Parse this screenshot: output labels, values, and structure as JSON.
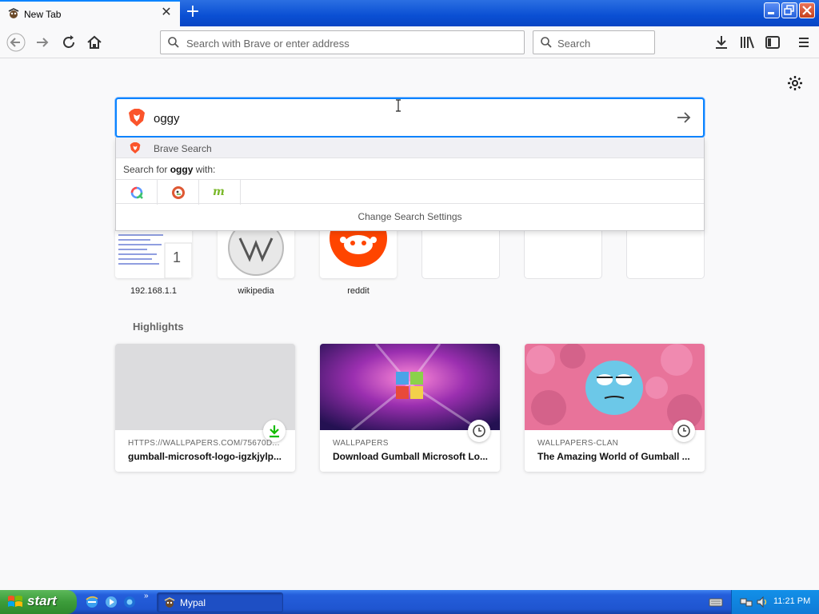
{
  "tab": {
    "title": "New Tab"
  },
  "url_bar": {
    "placeholder": "Search with Brave or enter address"
  },
  "search_bar": {
    "placeholder": "Search"
  },
  "main_search": {
    "value": "oggy"
  },
  "dropdown": {
    "engine_label": "Brave Search",
    "search_for_prefix": "Search for ",
    "search_for_term": "oggy",
    "search_for_suffix": " with:",
    "engines": [
      "qwant-icon",
      "duckduckgo-icon",
      "mojeek-icon"
    ],
    "change_settings": "Change Search Settings"
  },
  "top_sites": [
    {
      "label": "192.168.1.1",
      "badge": "1"
    },
    {
      "label": "wikipedia"
    },
    {
      "label": "reddit"
    },
    {
      "label": ""
    },
    {
      "label": ""
    },
    {
      "label": ""
    }
  ],
  "highlights": {
    "title": "Highlights",
    "cards": [
      {
        "source": "HTTPS://WALLPAPERS.COM/75670D...",
        "title": "gumball-microsoft-logo-igzkjylp...",
        "badge": "download-icon"
      },
      {
        "source": "WALLPAPERS",
        "title": "Download Gumball Microsoft Lo...",
        "badge": "clock-icon"
      },
      {
        "source": "WALLPAPERS-CLAN",
        "title": "The Amazing World of Gumball ...",
        "badge": "clock-icon"
      }
    ]
  },
  "taskbar": {
    "start_label": "start",
    "task_label": "Mypal",
    "clock": "11:21 PM"
  },
  "colors": {
    "accent": "#0a84ff",
    "taskbar_blue": "#245edb",
    "start_green": "#3c9c3a",
    "reddit_orange": "#ff4500",
    "download_green": "#12bc00"
  }
}
